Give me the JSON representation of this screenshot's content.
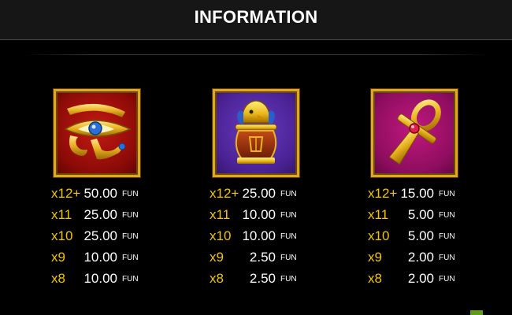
{
  "header": {
    "title": "INFORMATION"
  },
  "symbols": [
    {
      "icon": "eye-of-horus-icon",
      "background": "#a3110c",
      "rows": [
        {
          "mult": "x12+",
          "value": "50.00",
          "unit": "FUN"
        },
        {
          "mult": "x11",
          "value": "25.00",
          "unit": "FUN"
        },
        {
          "mult": "x10",
          "value": "25.00",
          "unit": "FUN"
        },
        {
          "mult": "x9",
          "value": "10.00",
          "unit": "FUN"
        },
        {
          "mult": "x8",
          "value": "10.00",
          "unit": "FUN"
        }
      ]
    },
    {
      "icon": "canopic-jar-icon",
      "background": "#4f2698",
      "rows": [
        {
          "mult": "x12+",
          "value": "25.00",
          "unit": "FUN"
        },
        {
          "mult": "x11",
          "value": "10.00",
          "unit": "FUN"
        },
        {
          "mult": "x10",
          "value": "10.00",
          "unit": "FUN"
        },
        {
          "mult": "x9",
          "value": "2.50",
          "unit": "FUN"
        },
        {
          "mult": "x8",
          "value": "2.50",
          "unit": "FUN"
        }
      ]
    },
    {
      "icon": "ankh-icon",
      "background": "#9c0f68",
      "rows": [
        {
          "mult": "x12+",
          "value": "15.00",
          "unit": "FUN"
        },
        {
          "mult": "x11",
          "value": "5.00",
          "unit": "FUN"
        },
        {
          "mult": "x10",
          "value": "5.00",
          "unit": "FUN"
        },
        {
          "mult": "x9",
          "value": "2.00",
          "unit": "FUN"
        },
        {
          "mult": "x8",
          "value": "2.00",
          "unit": "FUN"
        }
      ]
    }
  ],
  "colors": {
    "multiplier": "#f2c500",
    "frame": "#e0a820",
    "value": "#ffffff"
  }
}
